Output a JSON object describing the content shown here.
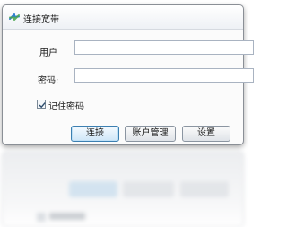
{
  "window": {
    "title": "连接宽带",
    "icon": "network-connection-icon"
  },
  "form": {
    "username_label": "用户",
    "username_value": "",
    "password_label": "密码:",
    "password_value": "",
    "remember_label": "记住密码",
    "remember_checked": true
  },
  "buttons": {
    "connect": "连接",
    "account_manage": "账户管理",
    "settings": "设置"
  },
  "colors": {
    "accent": "#3c7fb1",
    "border": "#8a8f96"
  }
}
